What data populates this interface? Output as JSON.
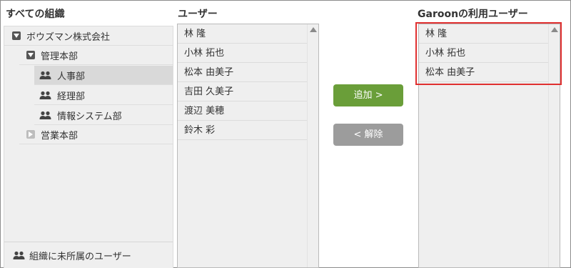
{
  "headings": {
    "organizations": "すべての組織",
    "users": "ユーザー",
    "garoon_users": "Garoonの利用ユーザー"
  },
  "org_tree": {
    "items": [
      {
        "label": "ボウズマン株式会社",
        "icon": "collapse-toggle-icon",
        "level": 0
      },
      {
        "label": "管理本部",
        "icon": "collapse-toggle-icon",
        "level": 1
      },
      {
        "label": "人事部",
        "icon": "group-icon",
        "level": 2,
        "selected": true
      },
      {
        "label": "経理部",
        "icon": "group-icon",
        "level": 2
      },
      {
        "label": "情報システム部",
        "icon": "group-icon",
        "level": 2
      },
      {
        "label": "営業本部",
        "icon": "expand-toggle-icon",
        "level": 1
      }
    ],
    "footer": {
      "label": "組織に未所属のユーザー",
      "icon": "group-icon"
    }
  },
  "user_list": {
    "items": [
      "林 隆",
      "小林 拓也",
      "松本 由美子",
      "吉田 久美子",
      "渡辺 美穂",
      "鈴木 彩"
    ]
  },
  "actions": {
    "add_label": "追加 >",
    "remove_label": "< 解除"
  },
  "garoon_user_list": {
    "items": [
      "林 隆",
      "小林 拓也",
      "松本 由美子"
    ]
  },
  "colors": {
    "add_button": "#6a9e39",
    "remove_button": "#9c9c9c",
    "highlight_border": "#e03030"
  }
}
